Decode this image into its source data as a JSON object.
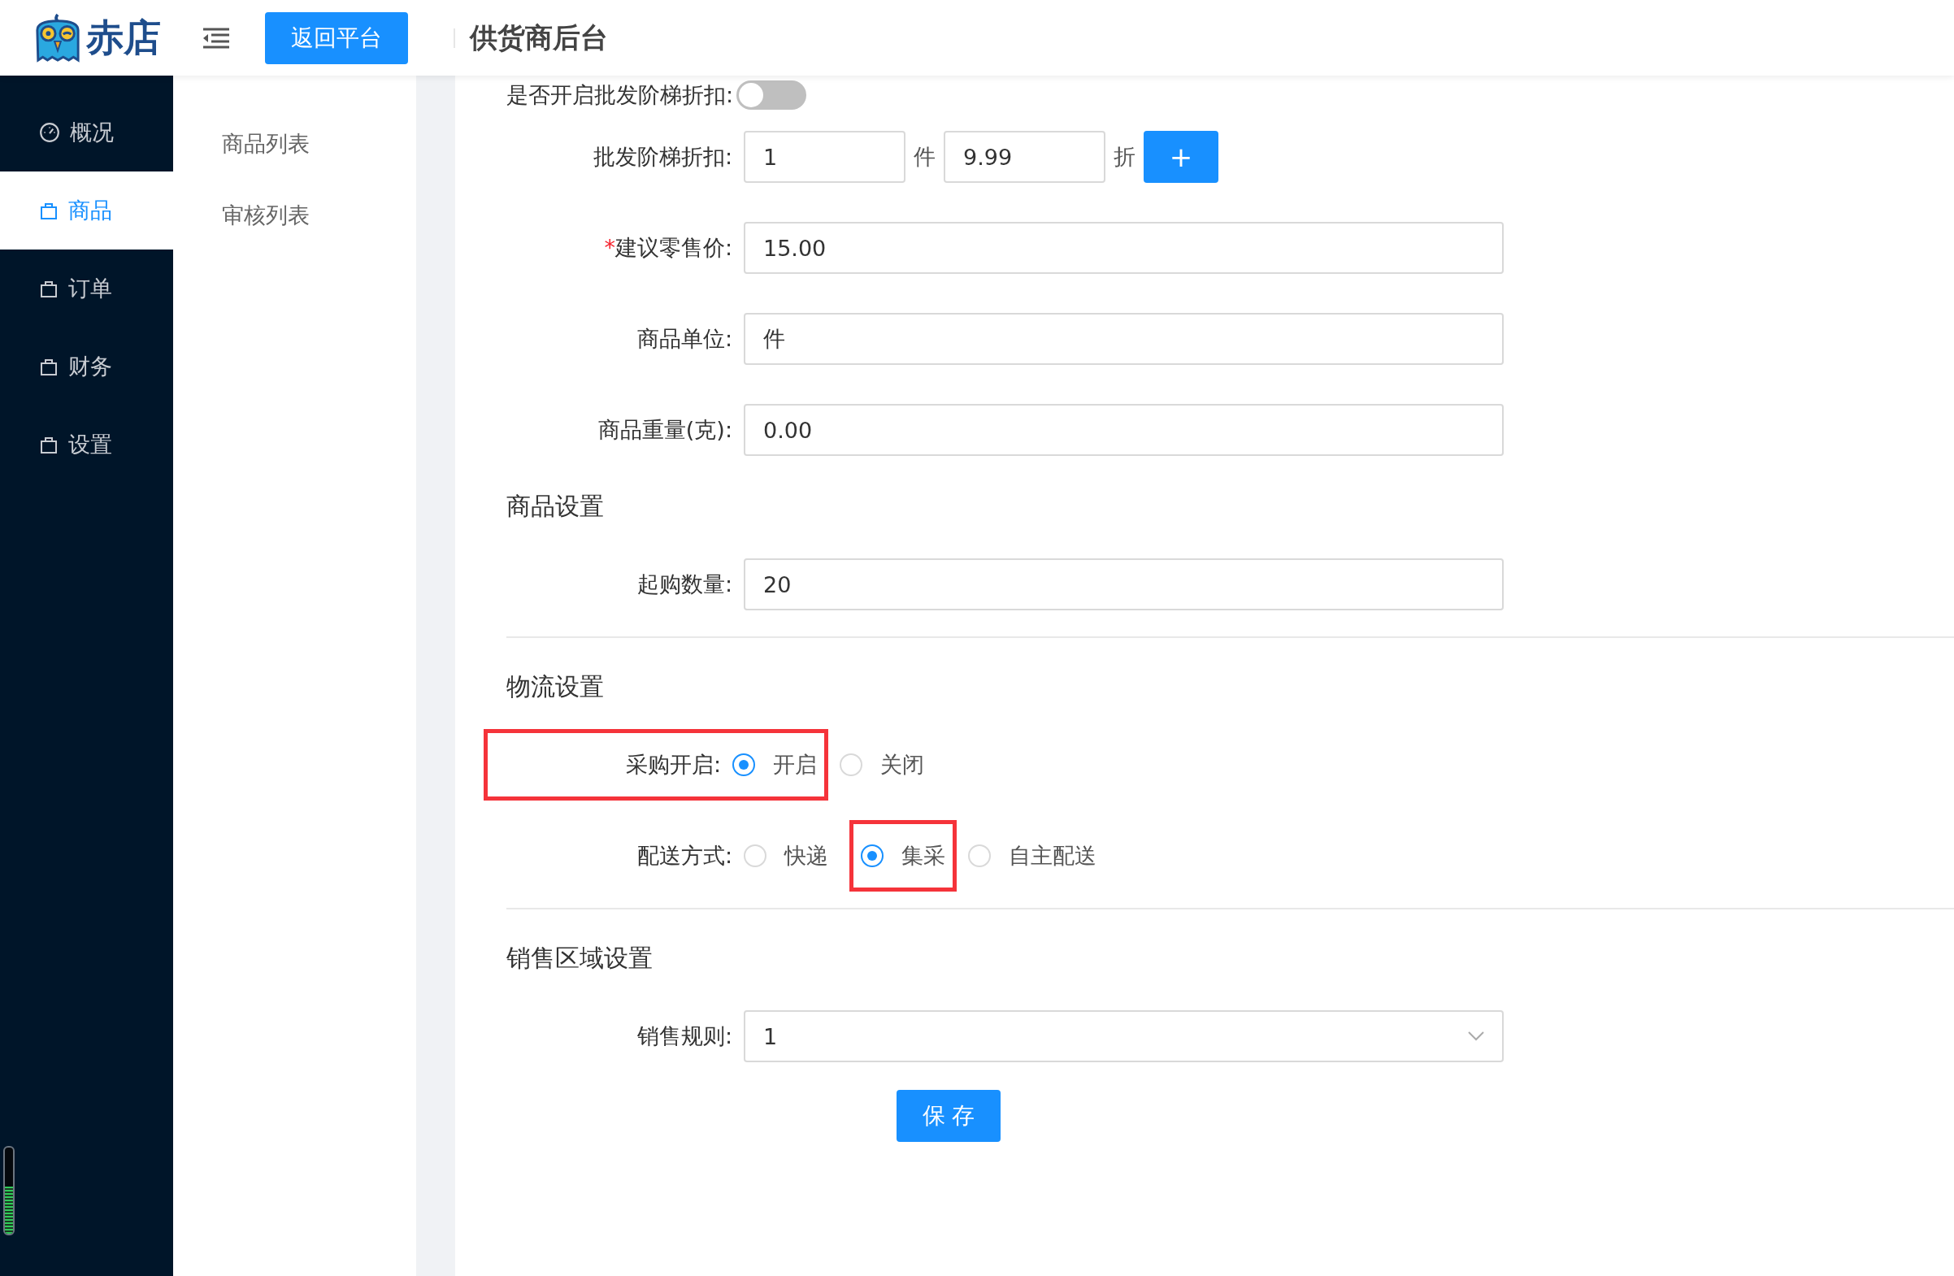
{
  "header": {
    "brand": "赤店",
    "back_button": "返回平台",
    "title": "供货商后台"
  },
  "sidebar": {
    "items": [
      {
        "label": "概况",
        "selected": false
      },
      {
        "label": "商品",
        "selected": true
      },
      {
        "label": "订单",
        "selected": false
      },
      {
        "label": "财务",
        "selected": false
      },
      {
        "label": "设置",
        "selected": false
      }
    ]
  },
  "submenu": {
    "items": [
      {
        "label": "商品列表"
      },
      {
        "label": "审核列表"
      }
    ]
  },
  "form": {
    "sections": [
      {
        "rows": [
          {
            "kind": "toggle",
            "label": "是否开启批发阶梯折扣:",
            "on": false
          },
          {
            "kind": "tier",
            "label": "批发阶梯折扣:",
            "qty": "1",
            "qty_unit": "件",
            "discount": "9.99",
            "discount_unit": "折",
            "add_button": "+"
          },
          {
            "kind": "input",
            "label": "建议零售价:",
            "required_mark": "*",
            "value": "15.00"
          },
          {
            "kind": "input",
            "label": "商品单位:",
            "value": "件"
          },
          {
            "kind": "input",
            "label": "商品重量(克):",
            "value": "0.00"
          }
        ]
      },
      {
        "title": "商品设置",
        "divider": true,
        "rows": [
          {
            "kind": "input",
            "label": "起购数量:",
            "value": "20"
          }
        ]
      },
      {
        "title": "物流设置",
        "divider": true,
        "rows": [
          {
            "kind": "radio",
            "label": "采购开启:",
            "label_highlighted": true,
            "options": [
              {
                "label": "开启",
                "selected": true,
                "highlighted": true
              },
              {
                "label": "关闭",
                "selected": false,
                "highlighted": false
              }
            ]
          },
          {
            "kind": "radio",
            "label": "配送方式:",
            "label_highlighted": false,
            "options": [
              {
                "label": "快递",
                "selected": false,
                "highlighted": false
              },
              {
                "label": "集采",
                "selected": true,
                "highlighted": true
              },
              {
                "label": "自主配送",
                "selected": false,
                "highlighted": false
              }
            ]
          }
        ]
      },
      {
        "title": "销售区域设置",
        "rows": [
          {
            "kind": "select",
            "label": "销售规则:",
            "value": "1"
          }
        ]
      }
    ],
    "save_button": "保 存"
  },
  "level_meter": {
    "level": 0.55
  }
}
